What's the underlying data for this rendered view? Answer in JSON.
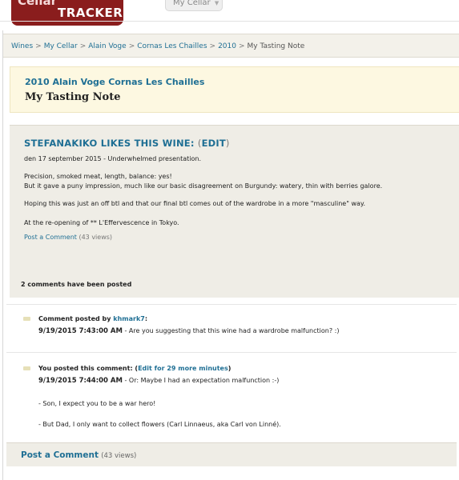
{
  "header": {
    "logo_top": "Cellar",
    "logo_bottom": "TRACKER",
    "cellar_tab": "My Cellar"
  },
  "breadcrumb": {
    "items": [
      "Wines",
      "My Cellar",
      "Alain Voge",
      "Cornas Les Chailles",
      "2010"
    ],
    "current": "My Tasting Note",
    "separator": ">"
  },
  "title": {
    "wine": "2010 Alain Voge Cornas Les Chailles",
    "page_title": "My Tasting Note"
  },
  "note": {
    "heading_prefix": "STEFANAKIKO LIKES THIS WINE:",
    "paren_open": "(",
    "edit_label": "EDIT",
    "paren_close": ")",
    "date_line": "den 17 september 2015 - Underwhelmed presentation.",
    "p1": "Precision, smoked meat, length, balance: yes!",
    "p2": "But it gave a puny impression, much like our basic disagreement on Burgundy: watery, thin with berries galore.",
    "p3": "Hoping this was just an off btl and that our final btl comes out of the wardrobe in a more \"masculine\" way.",
    "p4": "At the re-opening of ** L'Effervescence in Tokyo.",
    "post_comment_label": "Post a Comment",
    "views": "(43 views)"
  },
  "comments": {
    "count_text": "2 comments have been posted",
    "items": [
      {
        "by_prefix": "Comment posted by",
        "author": "khmark7",
        "by_suffix": ":",
        "timestamp": "9/19/2015 7:43:00 AM",
        "text": " - Are you suggesting that this wine had a wardrobe malfunction? :)"
      },
      {
        "by_prefix": "You posted this comment: (",
        "edit_label": "Edit for 29 more minutes",
        "by_suffix": ")",
        "timestamp": "9/19/2015 7:44:00 AM",
        "text": " - Or: Maybe I had an expectation malfunction :-)",
        "body1": "- Son, I expect you to be a war hero!",
        "body2": "- But Dad, I only want to collect flowers (Carl Linnaeus, aka Carl von Linné)."
      }
    ]
  },
  "footer": {
    "post_comment_label": "Post a Comment",
    "views": "(43 views)"
  },
  "colors": {
    "link": "#1f6f94",
    "logo": "#8a1d1d",
    "title_bg": "#fdf8e1",
    "panel_bg": "#efede6"
  }
}
